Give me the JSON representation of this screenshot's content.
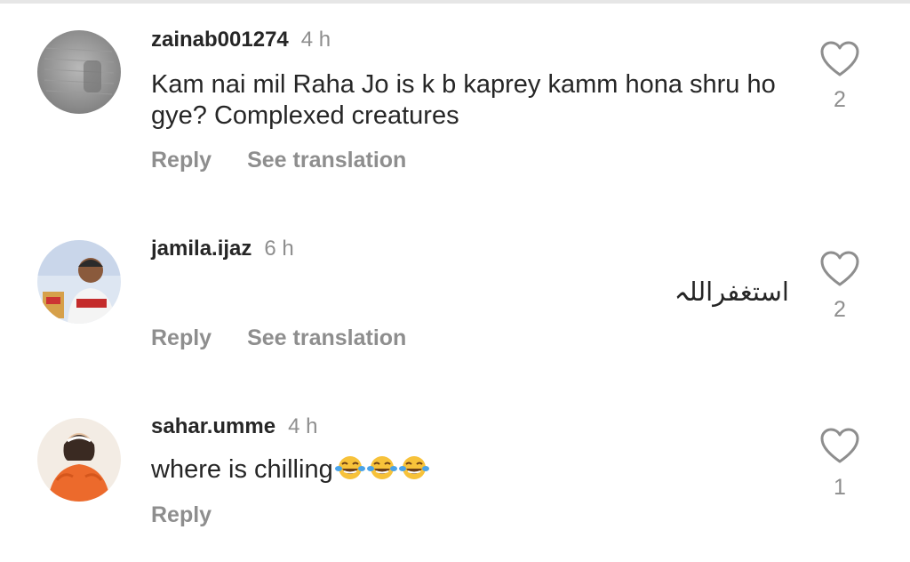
{
  "comments": [
    {
      "username": "zainab001274",
      "time": "4 h",
      "text": "Kam nai mil Raha Jo is k b kaprey kamm hona shru ho gye? Complexed creatures",
      "reply_label": "Reply",
      "translate_label": "See translation",
      "likes": "2",
      "avatar_icon": "avatar-gray-photo"
    },
    {
      "username": "jamila.ijaz",
      "time": "6 h",
      "text": "استغفراللہ",
      "reply_label": "Reply",
      "translate_label": "See translation",
      "likes": "2",
      "avatar_icon": "avatar-child-photo"
    },
    {
      "username": "sahar.umme",
      "time": "4 h",
      "text": "where is chilling",
      "emojis": [
        "tears-of-joy-emoji",
        "tears-of-joy-emoji",
        "tears-of-joy-emoji"
      ],
      "reply_label": "Reply",
      "likes": "1",
      "avatar_icon": "avatar-girl-orange-photo"
    }
  ],
  "colors": {
    "text": "#262626",
    "secondary": "#8e8e8e",
    "divider": "#e6e6e6"
  }
}
